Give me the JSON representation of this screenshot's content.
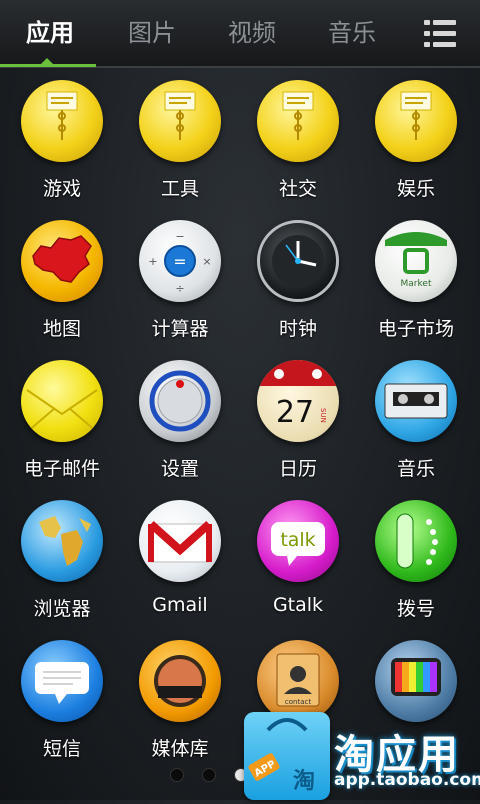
{
  "tabs": [
    {
      "label": "应用",
      "active": true
    },
    {
      "label": "图片",
      "active": false
    },
    {
      "label": "视频",
      "active": false
    },
    {
      "label": "音乐",
      "active": false
    }
  ],
  "apps": [
    {
      "label": "游戏",
      "icon": "folder-envelope-icon"
    },
    {
      "label": "工具",
      "icon": "folder-envelope-icon"
    },
    {
      "label": "社交",
      "icon": "folder-envelope-icon"
    },
    {
      "label": "娱乐",
      "icon": "folder-envelope-icon"
    },
    {
      "label": "地图",
      "icon": "china-map-icon"
    },
    {
      "label": "计算器",
      "icon": "calculator-icon"
    },
    {
      "label": "时钟",
      "icon": "clock-icon"
    },
    {
      "label": "电子市场",
      "icon": "market-bag-icon"
    },
    {
      "label": "电子邮件",
      "icon": "mail-envelope-icon"
    },
    {
      "label": "设置",
      "icon": "settings-knob-icon"
    },
    {
      "label": "日历",
      "icon": "calendar-icon"
    },
    {
      "label": "音乐",
      "icon": "cassette-icon"
    },
    {
      "label": "浏览器",
      "icon": "globe-icon"
    },
    {
      "label": "Gmail",
      "icon": "gmail-icon"
    },
    {
      "label": "Gtalk",
      "icon": "gtalk-icon"
    },
    {
      "label": "拨号",
      "icon": "dialer-icon"
    },
    {
      "label": "短信",
      "icon": "sms-bubble-icon"
    },
    {
      "label": "媒体库",
      "icon": "gallery-icon"
    },
    {
      "label": "",
      "icon": "contacts-icon"
    },
    {
      "label": "",
      "icon": "tv-icon"
    }
  ],
  "icon_text": {
    "market": "Market",
    "calendar_day": "27",
    "calendar_weekday": "SUN",
    "talk": "talk",
    "contact": "contact"
  },
  "page_dots": {
    "count": 3,
    "active": 3
  },
  "brand": {
    "title": "淘应用",
    "url": "app.taobao.com",
    "bag_badge": "APP",
    "bag_char": "淘"
  }
}
